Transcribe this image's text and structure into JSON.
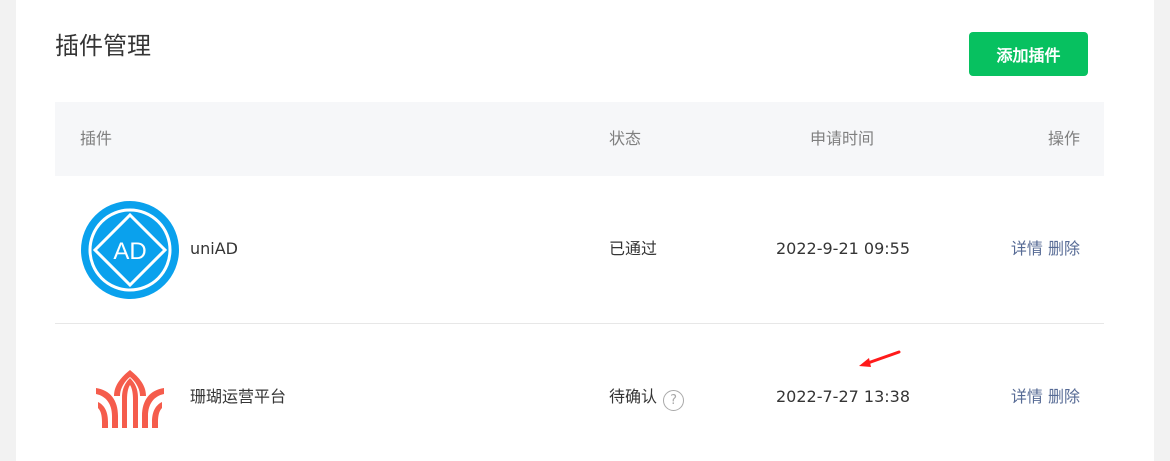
{
  "page": {
    "title": "插件管理",
    "add_button_label": "添加插件"
  },
  "table": {
    "columns": {
      "plugin": "插件",
      "status": "状态",
      "apply_time": "申请时间",
      "actions": "操作"
    },
    "rows": [
      {
        "name": "uniAD",
        "logo_text": "AD",
        "logo_icon": "uniad-logo-icon",
        "status": "已通过",
        "apply_time": "2022-9-21 09:55",
        "detail_label": "详情",
        "delete_label": "删除"
      },
      {
        "name": "珊瑚运营平台",
        "logo_icon": "coral-logo-icon",
        "status": "待确认",
        "help_icon": "?",
        "apply_time": "2022-7-27 13:38",
        "detail_label": "详情",
        "delete_label": "删除"
      }
    ]
  },
  "colors": {
    "primary_green": "#07c160",
    "link_blue": "#576b95",
    "uniad_blue": "#0aa1ed",
    "coral_red": "#f55c4c",
    "annotation_red": "#ff1a1a"
  }
}
